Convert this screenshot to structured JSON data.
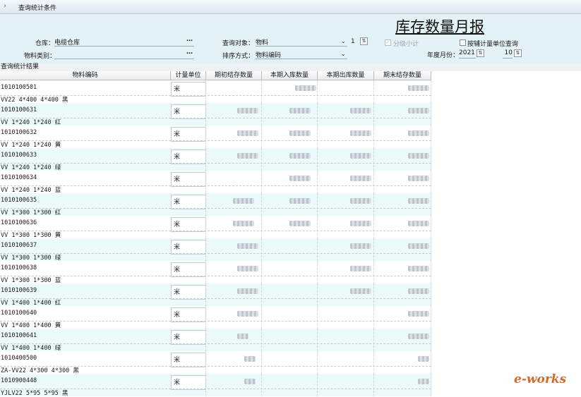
{
  "titlebar": {
    "icon": "chevron-right-icon",
    "title": "查询统计条件"
  },
  "report_title": "库存数量月报",
  "conditions": {
    "warehouse_label": "仓库：",
    "warehouse_value": "电缆仓库",
    "material_category_label": "物料类别：",
    "material_category_value": "",
    "browse_glyph": "…",
    "query_object_label": "查询对象：",
    "query_object_value": "物料",
    "query_object_level": "1",
    "sort_label": "排序方式：",
    "sort_value": "物料编码",
    "subtotal_label": "分级小计",
    "aux_unit_label": "按辅计量单位查询",
    "period_label": "年度月份：",
    "year": "2021",
    "month": "10",
    "spin_glyph": "⇅"
  },
  "results_label": "查询统计结果",
  "table": {
    "columns": [
      "物料编码",
      "计量单位",
      "期初结存数量",
      "本期入库数量",
      "本期出库数量",
      "期末结存数量"
    ],
    "rows": [
      {
        "code": "1010100501",
        "desc": "VV22 4*400  4*400  黑",
        "unit": "米"
      },
      {
        "code": "1010100631",
        "desc": "VV 1*240  1*240  红",
        "unit": "米"
      },
      {
        "code": "1010100632",
        "desc": "VV 1*240  1*240  黄",
        "unit": "米"
      },
      {
        "code": "1010100633",
        "desc": "VV 1*240  1*240  绿",
        "unit": "米"
      },
      {
        "code": "1010100634",
        "desc": "VV 1*240  1*240  蓝",
        "unit": "米"
      },
      {
        "code": "1010100635",
        "desc": "VV 1*300  1*300  红",
        "unit": "米"
      },
      {
        "code": "1010100636",
        "desc": "VV 1*300  1*300  黄",
        "unit": "米"
      },
      {
        "code": "1010100637",
        "desc": "VV 1*300  1*300  绿",
        "unit": "米"
      },
      {
        "code": "1010100638",
        "desc": "VV 1*300  1*300  蓝",
        "unit": "米"
      },
      {
        "code": "1010100639",
        "desc": "VV 1*400  1*400  红",
        "unit": "米"
      },
      {
        "code": "1010100640",
        "desc": "VV 1*400  1*400  黄",
        "unit": "米"
      },
      {
        "code": "1010100641",
        "desc": "VV 1*400  1*400  绿",
        "unit": "米"
      },
      {
        "code": "1010400500",
        "desc": "ZA-VV22 4*300  4*300  黑",
        "unit": "米"
      },
      {
        "code": "1010900448",
        "desc": "YJLV22 5*95  5*95  黑",
        "unit": "米"
      }
    ]
  },
  "watermark": {
    "brand": "e-works"
  }
}
